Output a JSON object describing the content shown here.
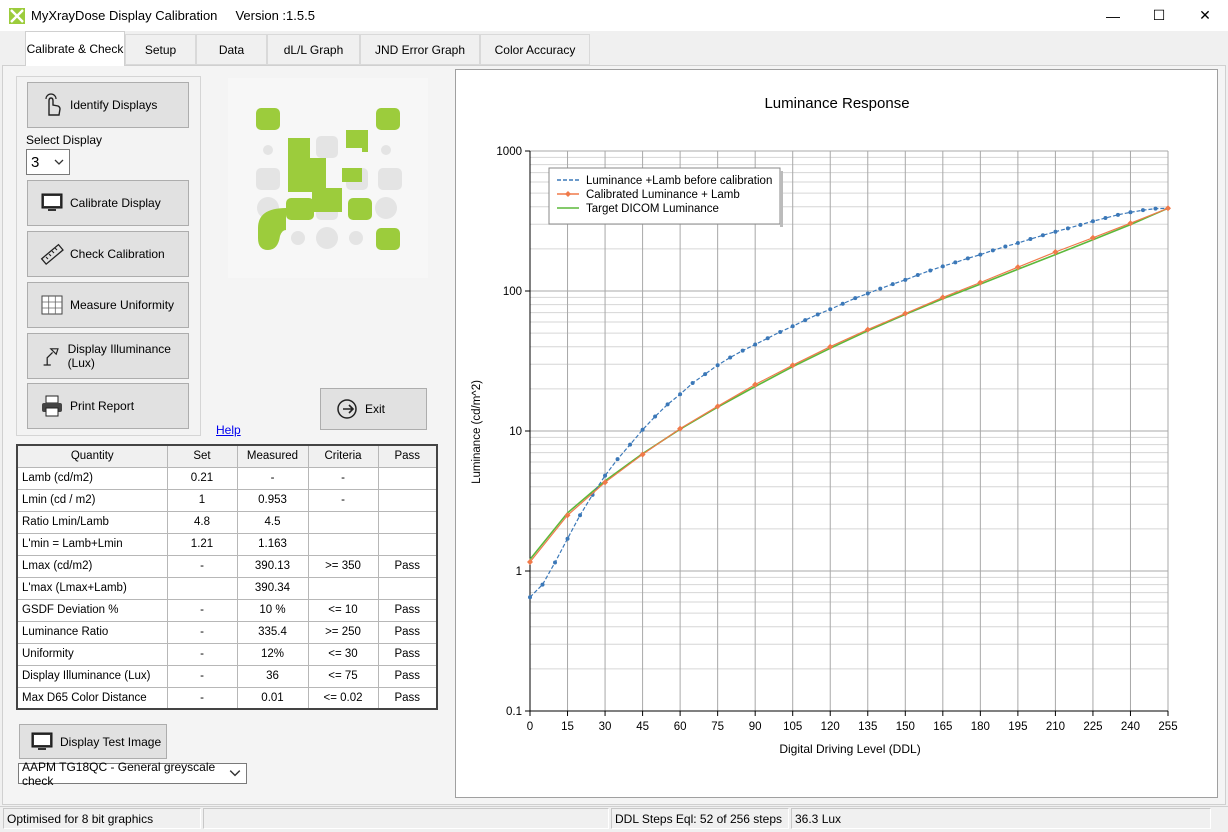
{
  "window": {
    "title": "MyXrayDose Display Calibration     Version :1.5.5",
    "minimize": "—",
    "maximize": "☐",
    "close": "✕"
  },
  "tabs": [
    {
      "label": "Calibrate & Check",
      "active": true
    },
    {
      "label": "Setup"
    },
    {
      "label": "Data"
    },
    {
      "label": "dL/L Graph"
    },
    {
      "label": "JND Error Graph"
    },
    {
      "label": "Color Accuracy"
    }
  ],
  "buttons": {
    "identify": "Identify Displays",
    "calibrate": "Calibrate Display",
    "check": "Check Calibration",
    "uniformity": "Measure Uniformity",
    "illuminance": "Display Illuminance (Lux)",
    "print": "Print Report",
    "exit": "Exit",
    "test_image": "Display Test Image"
  },
  "icons": {
    "identify": "hand-pointer-icon",
    "calibrate": "monitor-icon",
    "check": "ruler-icon",
    "uniformity": "grid-icon",
    "illuminance": "desk-lamp-icon",
    "print": "printer-icon",
    "exit": "exit-arrow-icon",
    "test_image": "monitor-icon",
    "app": "app-logo-icon"
  },
  "select_display": {
    "label": "Select Display",
    "value": "3"
  },
  "help_link": "Help",
  "table": {
    "headers": [
      "Quantity",
      "Set",
      "Measured",
      "Criteria",
      "Pass"
    ],
    "rows": [
      [
        "Lamb (cd/m2)",
        "0.21",
        "-",
        "-",
        ""
      ],
      [
        "Lmin (cd / m2)",
        "1",
        "0.953",
        "-",
        ""
      ],
      [
        "Ratio Lmin/Lamb",
        "4.8",
        "4.5",
        "",
        ""
      ],
      [
        "L'min = Lamb+Lmin",
        "1.21",
        "1.163",
        "",
        ""
      ],
      [
        "Lmax (cd/m2)",
        "-",
        "390.13",
        ">= 350",
        "Pass"
      ],
      [
        "L'max (Lmax+Lamb)",
        "",
        "390.34",
        "",
        ""
      ],
      [
        "GSDF Deviation %",
        "-",
        "10 %",
        "<= 10",
        "Pass"
      ],
      [
        "Luminance Ratio",
        "-",
        "335.4",
        ">= 250",
        "Pass"
      ],
      [
        "Uniformity",
        "-",
        "12%",
        "<= 30",
        "Pass"
      ],
      [
        "Display Illuminance (Lux)",
        "-",
        "36",
        "<= 75",
        "Pass"
      ],
      [
        "Max D65 Color Distance",
        "-",
        "0.01",
        "<= 0.02",
        "Pass"
      ]
    ]
  },
  "test_image_select": {
    "value": "AAPM TG18QC - General greyscale check"
  },
  "status": {
    "left": "Optimised for 8 bit graphics",
    "middle": "",
    "steps": "DDL Steps Eql: 52 of 256 steps",
    "lux": "36.3 Lux"
  },
  "colors": {
    "before": "#3b78b8",
    "calibrated": "#f07a4a",
    "target": "#5cb83a",
    "logo_green": "#9ccc3c",
    "logo_gray": "#e4e4e4"
  },
  "chart_data": {
    "type": "line",
    "title": "Luminance Response",
    "xlabel": "Digital Driving Level (DDL)",
    "ylabel": "Luminance (cd/m^2)",
    "xlim": [
      0,
      255
    ],
    "ylim": [
      0.1,
      1000
    ],
    "yscale": "log",
    "xticks": [
      0,
      15,
      30,
      45,
      60,
      75,
      90,
      105,
      120,
      135,
      150,
      165,
      180,
      195,
      210,
      225,
      240,
      255
    ],
    "yticks": [
      0.1,
      1,
      10,
      100,
      1000
    ],
    "ytick_labels": [
      "0.1",
      "1",
      "10",
      "100",
      "1000"
    ],
    "grid": true,
    "legend": "top-left",
    "series": [
      {
        "name": "Luminance +Lamb before calibration",
        "style": "dashed-dots",
        "x": [
          0,
          5,
          10,
          15,
          20,
          25,
          30,
          35,
          40,
          45,
          50,
          55,
          60,
          65,
          70,
          75,
          80,
          85,
          90,
          95,
          100,
          105,
          110,
          115,
          120,
          125,
          130,
          135,
          140,
          145,
          150,
          155,
          160,
          165,
          170,
          175,
          180,
          185,
          190,
          195,
          200,
          205,
          210,
          215,
          220,
          225,
          230,
          235,
          240,
          245,
          250,
          255
        ],
        "y": [
          0.65,
          0.8,
          1.15,
          1.7,
          2.5,
          3.5,
          4.8,
          6.3,
          8.0,
          10.2,
          12.7,
          15.5,
          18.3,
          22.0,
          25.5,
          29.5,
          33.5,
          37.5,
          41.5,
          46.0,
          51.0,
          56.0,
          62.0,
          68.0,
          74.0,
          81.0,
          89.0,
          96.0,
          104.0,
          112.0,
          120.0,
          130.0,
          140.0,
          150.0,
          160.0,
          171.0,
          182.0,
          195.0,
          208.0,
          220.0,
          235.0,
          250.0,
          265.0,
          280.0,
          297.0,
          315.0,
          332.0,
          350.0,
          365.0,
          378.0,
          388.0,
          390.0
        ]
      },
      {
        "name": "Calibrated Luminance + Lamb",
        "style": "solid-diamonds",
        "x": [
          0,
          15,
          30,
          45,
          60,
          75,
          90,
          105,
          120,
          135,
          150,
          165,
          180,
          195,
          210,
          225,
          240,
          255
        ],
        "y": [
          1.16,
          2.5,
          4.3,
          6.8,
          10.4,
          15.0,
          21.5,
          29.5,
          40.0,
          53.0,
          69.0,
          90.0,
          115.0,
          148.0,
          190.0,
          240.0,
          305.0,
          390.0
        ]
      },
      {
        "name": "Target DICOM Luminance",
        "style": "solid",
        "x": [
          0,
          15,
          30,
          45,
          60,
          75,
          90,
          105,
          120,
          135,
          150,
          165,
          180,
          195,
          210,
          225,
          240,
          255
        ],
        "y": [
          1.21,
          2.6,
          4.4,
          6.9,
          10.3,
          14.8,
          20.8,
          28.8,
          39.0,
          52.0,
          68.0,
          88.0,
          112.0,
          143.0,
          182.0,
          232.0,
          298.0,
          390.0
        ]
      }
    ]
  }
}
